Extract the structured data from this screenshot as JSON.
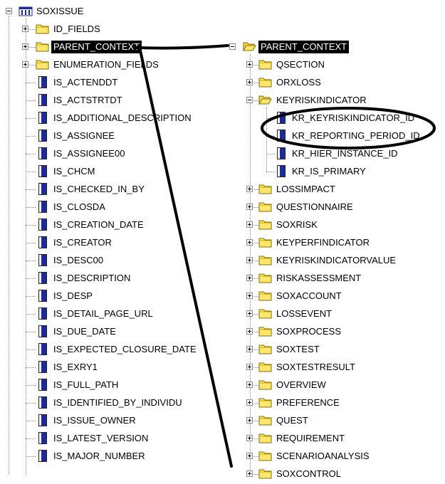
{
  "left_tree": {
    "root": "SOXISSUE",
    "folders": [
      "ID_FIELDS",
      "PARENT_CONTEXT",
      "ENUMERATION_FIELDS"
    ],
    "fields": [
      "IS_ACTENDDT",
      "IS_ACTSTRTDT",
      "IS_ADDITIONAL_DESCRIPTION",
      "IS_ASSIGNEE",
      "IS_ASSIGNEE00",
      "IS_CHCM",
      "IS_CHECKED_IN_BY",
      "IS_CLOSDA",
      "IS_CREATION_DATE",
      "IS_CREATOR",
      "IS_DESC00",
      "IS_DESCRIPTION",
      "IS_DESP",
      "IS_DETAIL_PAGE_URL",
      "IS_DUE_DATE",
      "IS_EXPECTED_CLOSURE_DATE",
      "IS_EXRY1",
      "IS_FULL_PATH",
      "IS_IDENTIFIED_BY_INDIVIDU",
      "IS_ISSUE_OWNER",
      "IS_LATEST_VERSION",
      "IS_MAJOR_NUMBER"
    ]
  },
  "right_tree": {
    "root": "PARENT_CONTEXT",
    "folders_before": [
      "QSECTION",
      "ORXLOSS"
    ],
    "expanded_folder": "KEYRISKINDICATOR",
    "expanded_fields": [
      "KR_KEYRISKINDICATOR_ID",
      "KR_REPORTING_PERIOD_ID",
      "KR_HIER_INSTANCE_ID",
      "KR_IS_PRIMARY"
    ],
    "folders_after": [
      "LOSSIMPACT",
      "QUESTIONNAIRE",
      "SOXRISK",
      "KEYPERFINDICATOR",
      "KEYRISKINDICATORVALUE",
      "RISKASSESSMENT",
      "SOXACCOUNT",
      "LOSSEVENT",
      "SOXPROCESS",
      "SOXTEST",
      "SOXTESTRESULT",
      "OVERVIEW",
      "PREFERENCE",
      "QUEST",
      "REQUIREMENT",
      "SCENARIOANALYSIS",
      "SOXCONTROL"
    ]
  },
  "colors": {
    "selection_bg": "#000000",
    "folder_fill": "#fde76e",
    "field_icon": "#1b2a9c",
    "annotation_stroke": "#000000"
  },
  "icons": {
    "root": "database-table-icon",
    "folder": "folder-icon",
    "open_folder": "folder-open-icon",
    "field": "field-icon"
  }
}
